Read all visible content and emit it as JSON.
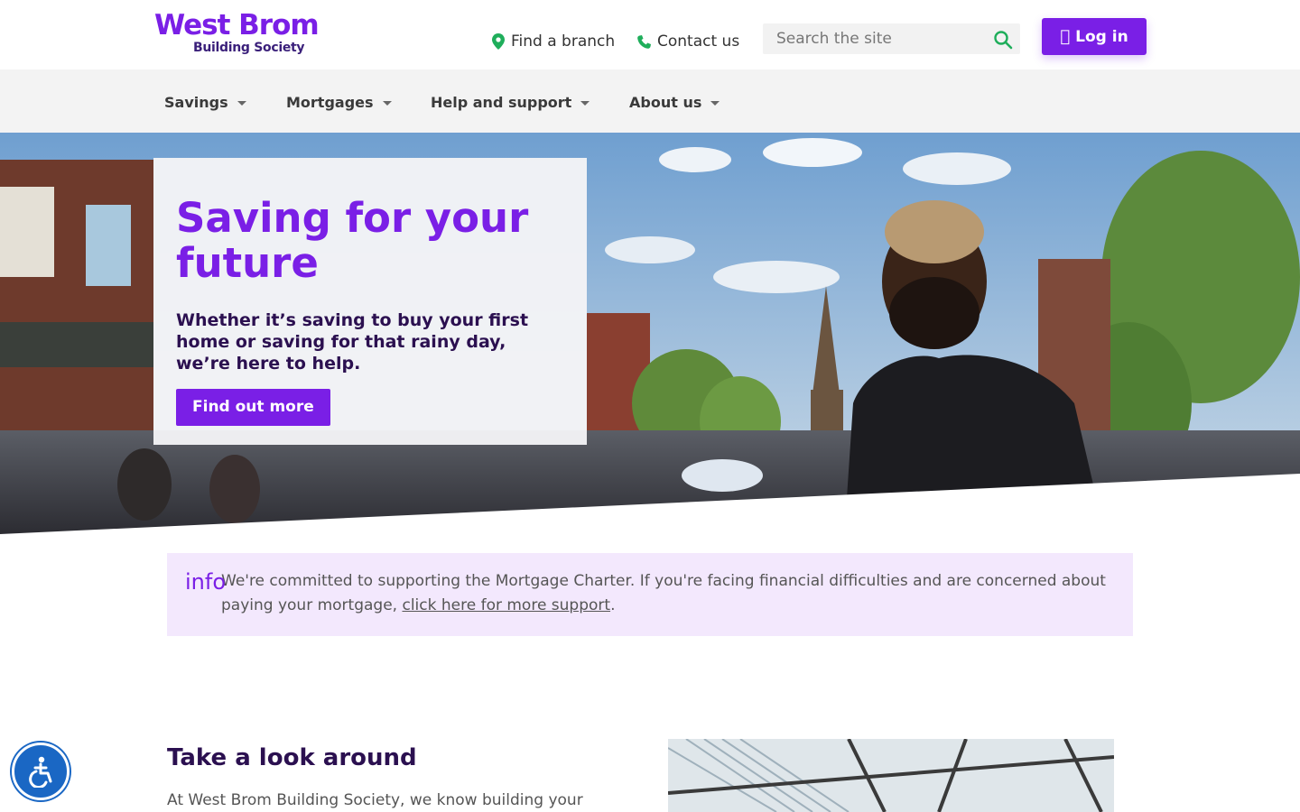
{
  "brand": {
    "name": "West Brom",
    "subtitle": "Building Society",
    "color": "#7a1fe6"
  },
  "header": {
    "find_branch": "Find a branch",
    "contact_us": "Contact us",
    "search_placeholder": "Search the site",
    "login_label": "Log in",
    "login_icon": "lock-icon"
  },
  "nav": {
    "items": [
      {
        "label": "Savings"
      },
      {
        "label": "Mortgages"
      },
      {
        "label": "Help and support"
      },
      {
        "label": "About us"
      }
    ]
  },
  "hero": {
    "title": "Saving for your future",
    "subtitle": "Whether it’s saving to buy your first home or saving for that rainy day, we’re here to help.",
    "button_label": "Find out more"
  },
  "notice": {
    "icon_label": "info",
    "text": "We're committed to supporting the Mortgage Charter. If you're facing financial difficulties and are concerned about paying your mortgage, ",
    "link_text": "click here for more support",
    "end": "."
  },
  "section": {
    "title": "Take a look around",
    "text": "At West Brom Building Society, we know building your"
  },
  "accessibility": {
    "icon": "accessibility-icon"
  }
}
